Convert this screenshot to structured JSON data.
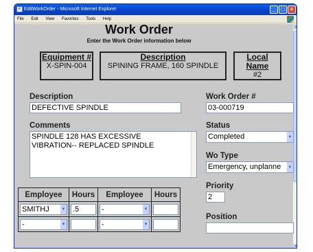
{
  "window": {
    "title": "EditWorkOrder - Microsoft Internet Explorer"
  },
  "menu": [
    "File",
    "Edit",
    "View",
    "Favorites",
    "Tools",
    "Help"
  ],
  "page": {
    "title": "Work Order",
    "subtitle": "Enter the Work Order information below"
  },
  "equipment": {
    "label": "Equipment #",
    "value": "X-SPIN-004"
  },
  "equip_description": {
    "label": "Description",
    "value": "SPINING FRAME, 160 SPINDLE"
  },
  "local_name": {
    "label": "Local Name",
    "value": "#2"
  },
  "description": {
    "label": "Description",
    "value": "DEFECTIVE SPINDLE"
  },
  "work_order": {
    "label": "Work Order #",
    "value": "03-000719"
  },
  "comments": {
    "label": "Comments",
    "line1": "SPINDLE 128 HAS EXCESSIVE",
    "line2": "VIBRATION-- REPLACED SPINDLE"
  },
  "status": {
    "label": "Status",
    "value": "Completed"
  },
  "wo_type": {
    "label": "Wo Type",
    "value": "Emergency, unplanne"
  },
  "priority": {
    "label": "Priority",
    "value": "2"
  },
  "position": {
    "label": "Position",
    "value": ""
  },
  "labor": {
    "headers": [
      "Employee",
      "Hours",
      "Employee",
      "Hours"
    ],
    "rows": [
      {
        "emp1": "SMITHJ",
        "hours1": ".5",
        "emp2": "-",
        "hours2": ""
      },
      {
        "emp1": "-",
        "hours1": "",
        "emp2": "-",
        "hours2": ""
      }
    ]
  },
  "colors": {
    "titlebar": "#0a5ef2",
    "form_bg": "#c9c9c9",
    "chrome": "#ece9d8"
  }
}
